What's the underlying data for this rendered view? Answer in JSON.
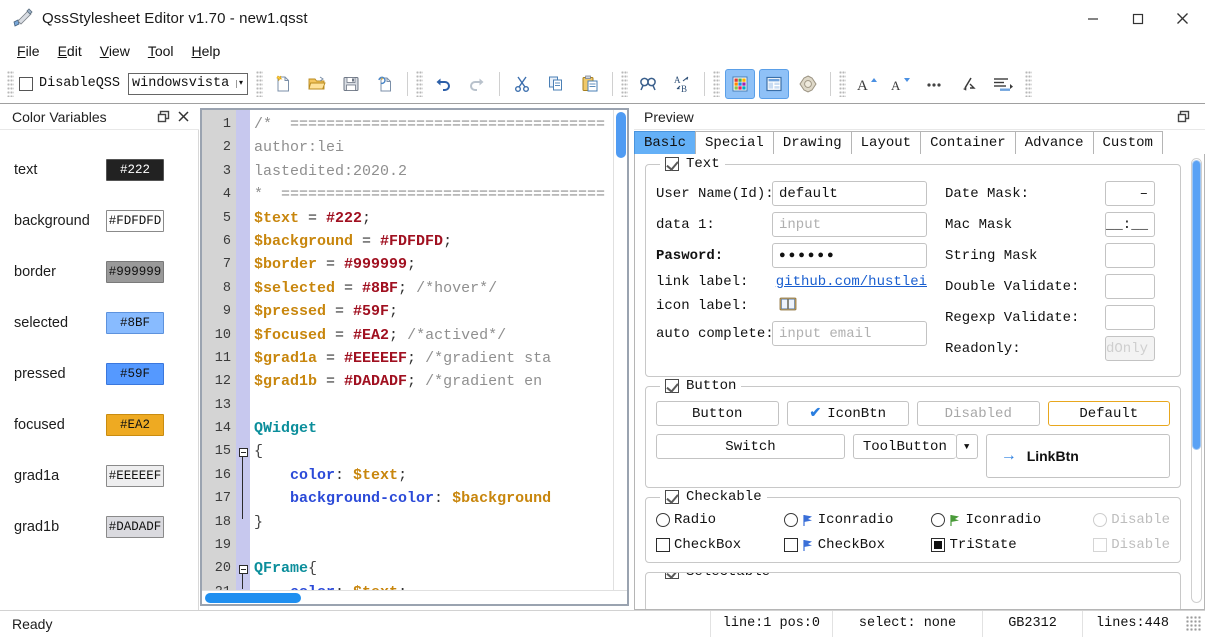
{
  "window": {
    "title": "QssStylesheet Editor v1.70 - new1.qsst",
    "app_icon": "paintbrush-icon",
    "minimize": "—",
    "maximize": "□",
    "close": "✕"
  },
  "menubar": {
    "items": [
      {
        "name": "file",
        "pre": "F",
        "post": "ile"
      },
      {
        "name": "edit",
        "pre": "E",
        "post": "dit"
      },
      {
        "name": "view",
        "pre": "V",
        "post": "iew"
      },
      {
        "name": "tool",
        "pre": "T",
        "post": "ool"
      },
      {
        "name": "help",
        "pre": "H",
        "post": "elp"
      }
    ]
  },
  "toolbar": {
    "disable_qss_label": "DisableQSS",
    "disable_qss_checked": false,
    "theme_value": "windowsvista",
    "theme_arrow": "▾",
    "buttons": [
      {
        "name": "new-file-icon",
        "title": "New"
      },
      {
        "name": "open-file-icon",
        "title": "Open"
      },
      {
        "name": "save-file-icon",
        "title": "Save"
      },
      {
        "name": "save-as-icon",
        "title": "Save As"
      },
      {
        "name": "undo-icon",
        "title": "Undo"
      },
      {
        "name": "redo-icon",
        "title": "Redo"
      },
      {
        "name": "cut-icon",
        "title": "Cut"
      },
      {
        "name": "copy-icon",
        "title": "Copy"
      },
      {
        "name": "paste-icon",
        "title": "Paste"
      },
      {
        "name": "find-icon",
        "title": "Find"
      },
      {
        "name": "replace-icon",
        "title": "Replace"
      },
      {
        "name": "color-panel-icon",
        "title": "Color Variables Panel"
      },
      {
        "name": "preview-panel-icon",
        "title": "Preview Panel"
      },
      {
        "name": "theme-icon",
        "title": "Theme"
      },
      {
        "name": "font-increase-icon",
        "title": "Increase Font"
      },
      {
        "name": "font-decrease-icon",
        "title": "Decrease Font"
      },
      {
        "name": "more-icon",
        "title": "More"
      },
      {
        "name": "wrap-icon",
        "title": "Wrap"
      },
      {
        "name": "indent-icon",
        "title": "Indent"
      }
    ]
  },
  "color_panel": {
    "title": "Color Variables",
    "float_icon": "float-icon",
    "close_icon": "close-icon",
    "variables": [
      {
        "name": "text",
        "value": "#222",
        "bg": "#222222",
        "fg": "#ffffff",
        "border": "#555555"
      },
      {
        "name": "background",
        "value": "#FDFDFD",
        "bg": "#FDFDFD",
        "fg": "#111111",
        "border": "#8a8a8a"
      },
      {
        "name": "border",
        "value": "#999999",
        "bg": "#999999",
        "fg": "#111111",
        "border": "#7a7a7a"
      },
      {
        "name": "selected",
        "value": "#8BF",
        "bg": "#88bbff",
        "fg": "#111111",
        "border": "#5d92dd"
      },
      {
        "name": "pressed",
        "value": "#59F",
        "bg": "#5599ff",
        "fg": "#111111",
        "border": "#3a77dd"
      },
      {
        "name": "focused",
        "value": "#EA2",
        "bg": "#eeaa22",
        "fg": "#111111",
        "border": "#c98c10"
      },
      {
        "name": "grad1a",
        "value": "#EEEEEF",
        "bg": "#EEEEEF",
        "fg": "#111111",
        "border": "#8a8a8a"
      },
      {
        "name": "grad1b",
        "value": "#DADADF",
        "bg": "#DADADF",
        "fg": "#111111",
        "border": "#8a8a8a"
      }
    ]
  },
  "editor": {
    "lines": [
      {
        "n": "1",
        "tokens": [
          {
            "t": "/*  ===================================",
            "c": "c-comment"
          }
        ]
      },
      {
        "n": "2",
        "tokens": [
          {
            "t": "author:lei",
            "c": "c-comment"
          }
        ]
      },
      {
        "n": "3",
        "tokens": [
          {
            "t": "lastedited:2020.2",
            "c": "c-comment"
          }
        ]
      },
      {
        "n": "4",
        "tokens": [
          {
            "t": "*  ====================================",
            "c": "c-comment"
          }
        ]
      },
      {
        "n": "5",
        "tokens": [
          {
            "t": "$text",
            "c": "c-var"
          },
          {
            "t": " = ",
            "c": "c-op"
          },
          {
            "t": "#222",
            "c": "c-hex"
          },
          {
            "t": ";",
            "c": "c-op"
          }
        ]
      },
      {
        "n": "6",
        "tokens": [
          {
            "t": "$background",
            "c": "c-var"
          },
          {
            "t": " = ",
            "c": "c-op"
          },
          {
            "t": "#FDFDFD",
            "c": "c-hex"
          },
          {
            "t": ";",
            "c": "c-op"
          }
        ]
      },
      {
        "n": "7",
        "tokens": [
          {
            "t": "$border",
            "c": "c-var"
          },
          {
            "t": " = ",
            "c": "c-op"
          },
          {
            "t": "#999999",
            "c": "c-hex"
          },
          {
            "t": ";",
            "c": "c-op"
          }
        ]
      },
      {
        "n": "8",
        "tokens": [
          {
            "t": "$selected",
            "c": "c-var"
          },
          {
            "t": " = ",
            "c": "c-op"
          },
          {
            "t": "#8BF",
            "c": "c-hex"
          },
          {
            "t": "; ",
            "c": "c-op"
          },
          {
            "t": "/*hover*/",
            "c": "c-comment"
          }
        ]
      },
      {
        "n": "9",
        "tokens": [
          {
            "t": "$pressed",
            "c": "c-var"
          },
          {
            "t": " = ",
            "c": "c-op"
          },
          {
            "t": "#59F",
            "c": "c-hex"
          },
          {
            "t": ";",
            "c": "c-op"
          }
        ]
      },
      {
        "n": "10",
        "tokens": [
          {
            "t": "$focused",
            "c": "c-var"
          },
          {
            "t": " = ",
            "c": "c-op"
          },
          {
            "t": "#EA2",
            "c": "c-hex"
          },
          {
            "t": "; ",
            "c": "c-op"
          },
          {
            "t": "/*actived*/",
            "c": "c-comment"
          }
        ]
      },
      {
        "n": "11",
        "tokens": [
          {
            "t": "$grad1a",
            "c": "c-var"
          },
          {
            "t": " = ",
            "c": "c-op"
          },
          {
            "t": "#EEEEEF",
            "c": "c-hex"
          },
          {
            "t": "; ",
            "c": "c-op"
          },
          {
            "t": "/*gradient sta",
            "c": "c-comment"
          }
        ]
      },
      {
        "n": "12",
        "tokens": [
          {
            "t": "$grad1b",
            "c": "c-var"
          },
          {
            "t": " = ",
            "c": "c-op"
          },
          {
            "t": "#DADADF",
            "c": "c-hex"
          },
          {
            "t": "; ",
            "c": "c-op"
          },
          {
            "t": "/*gradient en",
            "c": "c-comment"
          }
        ]
      },
      {
        "n": "13",
        "tokens": []
      },
      {
        "n": "14",
        "tokens": [
          {
            "t": "QWidget",
            "c": "c-type"
          }
        ]
      },
      {
        "n": "15",
        "tokens": [
          {
            "t": "{",
            "c": "c-brace"
          }
        ],
        "fold": "start"
      },
      {
        "n": "16",
        "tokens": [
          {
            "t": "    ",
            "c": "c-op"
          },
          {
            "t": "color",
            "c": "c-prop"
          },
          {
            "t": ": ",
            "c": "c-op"
          },
          {
            "t": "$text",
            "c": "c-var"
          },
          {
            "t": ";",
            "c": "c-op"
          }
        ],
        "inner": true
      },
      {
        "n": "17",
        "tokens": [
          {
            "t": "    ",
            "c": "c-op"
          },
          {
            "t": "background-color",
            "c": "c-prop"
          },
          {
            "t": ": ",
            "c": "c-op"
          },
          {
            "t": "$background",
            "c": "c-var"
          }
        ],
        "inner": true
      },
      {
        "n": "18",
        "tokens": [
          {
            "t": "}",
            "c": "c-brace"
          }
        ],
        "fold": "end"
      },
      {
        "n": "19",
        "tokens": []
      },
      {
        "n": "20",
        "tokens": [
          {
            "t": "QFrame",
            "c": "c-type"
          },
          {
            "t": "{",
            "c": "c-brace"
          }
        ],
        "fold": "start"
      },
      {
        "n": "21",
        "tokens": [
          {
            "t": "    ",
            "c": "c-op"
          },
          {
            "t": "color",
            "c": "c-prop"
          },
          {
            "t": ": ",
            "c": "c-op"
          },
          {
            "t": "$text",
            "c": "c-var"
          },
          {
            "t": ";",
            "c": "c-op"
          }
        ],
        "inner": true
      }
    ]
  },
  "preview": {
    "title": "Preview",
    "float_icon": "float-icon",
    "tabs": [
      {
        "label": "Basic",
        "selected": true
      },
      {
        "label": "Special",
        "selected": false
      },
      {
        "label": "Drawing",
        "selected": false
      },
      {
        "label": "Layout",
        "selected": false
      },
      {
        "label": "Container",
        "selected": false
      },
      {
        "label": "Advance",
        "selected": false
      },
      {
        "label": "Custom",
        "selected": false
      }
    ],
    "text_group": {
      "title": "Text",
      "checked": true,
      "left": [
        {
          "label": "User Name(Id):",
          "value": "default",
          "placeholder": "",
          "bold": false,
          "kind": "text"
        },
        {
          "label": "data 1:",
          "value": "",
          "placeholder": "input",
          "bold": false,
          "kind": "text"
        },
        {
          "label": "Pasword:",
          "value": "●●●●●●",
          "placeholder": "",
          "bold": true,
          "kind": "password"
        },
        {
          "label": "link label:",
          "value": "github.com/hustlei",
          "placeholder": "",
          "bold": false,
          "kind": "link"
        },
        {
          "label": "icon label:",
          "value": "",
          "placeholder": "",
          "bold": false,
          "kind": "icon"
        },
        {
          "label": "auto complete:",
          "value": "",
          "placeholder": "input email",
          "bold": false,
          "kind": "text"
        }
      ],
      "right": [
        {
          "label": "Date Mask:",
          "value": "–",
          "disabled": false
        },
        {
          "label": "Mac Mask",
          "value": "__:__",
          "disabled": false
        },
        {
          "label": "String Mask",
          "value": "",
          "disabled": false
        },
        {
          "label": "Double Validate:",
          "value": "",
          "disabled": false
        },
        {
          "label": "Regexp Validate:",
          "value": "",
          "disabled": false
        },
        {
          "label": "Readonly:",
          "value": "dOnly",
          "disabled": true
        }
      ]
    },
    "button_group": {
      "title": "Button",
      "checked": true,
      "row1": [
        {
          "label": "Button",
          "style": "normal"
        },
        {
          "label": "IconBtn",
          "style": "icon"
        },
        {
          "label": "Disabled",
          "style": "disabled"
        },
        {
          "label": "Default",
          "style": "default"
        }
      ],
      "row2": [
        {
          "label": "Switch",
          "style": "normal"
        },
        {
          "label": "ToolButton",
          "style": "tool"
        },
        {
          "label": "LinkBtn",
          "style": "link"
        }
      ]
    },
    "checkable_group": {
      "title": "Checkable",
      "checked": true,
      "radios": [
        {
          "label": "Radio",
          "icon": "none",
          "disabled": false
        },
        {
          "label": "Iconradio",
          "icon": "blue",
          "disabled": false
        },
        {
          "label": "Iconradio",
          "icon": "green",
          "disabled": false
        },
        {
          "label": "Disable",
          "icon": "none",
          "disabled": true
        }
      ],
      "checks": [
        {
          "label": "CheckBox",
          "icon": "none",
          "state": "unchecked",
          "disabled": false
        },
        {
          "label": "CheckBox",
          "icon": "blue",
          "state": "unchecked",
          "disabled": false
        },
        {
          "label": "TriState",
          "icon": "none",
          "state": "tristate",
          "disabled": false
        },
        {
          "label": "Disable",
          "icon": "none",
          "state": "unchecked",
          "disabled": true
        }
      ]
    },
    "selectable_group": {
      "title": "Selectable",
      "checked": true
    }
  },
  "statusbar": {
    "ready": "Ready",
    "cells": [
      "line:1  pos:0",
      "select: none",
      "GB2312",
      "lines:448"
    ]
  }
}
